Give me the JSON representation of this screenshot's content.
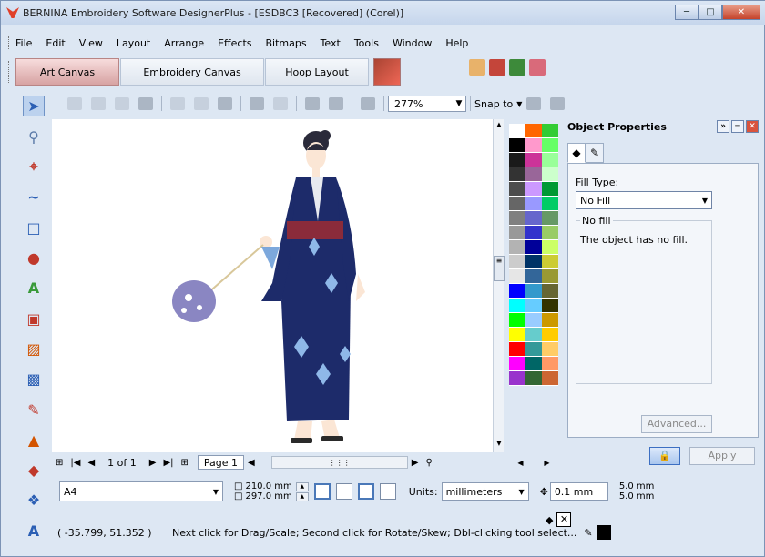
{
  "window": {
    "title": "BERNINA Embroidery Software DesignerPlus - [ESDBC3 [Recovered] (Corel)]"
  },
  "menu": [
    "File",
    "Edit",
    "View",
    "Layout",
    "Arrange",
    "Effects",
    "Bitmaps",
    "Text",
    "Tools",
    "Window",
    "Help"
  ],
  "canvas_tabs": [
    "Art Canvas",
    "Embroidery Canvas",
    "Hoop Layout"
  ],
  "toolbar": {
    "zoom": "277%",
    "snap_to": "Snap to"
  },
  "page_nav": {
    "count": "1 of 1",
    "page_tab": "Page 1"
  },
  "properties": {
    "title": "Object Properties",
    "fill_type_label": "Fill Type:",
    "fill_type_value": "No Fill",
    "group_title": "No fill",
    "group_desc": "The object has no fill.",
    "advanced_button": "Advanced...",
    "apply_button": "Apply"
  },
  "page_setup": {
    "paper": "A4",
    "width": "210.0 mm",
    "height": "297.0 mm",
    "units_label": "Units:",
    "units_value": "millimeters",
    "nudge": "0.1 mm",
    "dup_x": "5.0 mm",
    "dup_y": "5.0 mm"
  },
  "status": {
    "coords": "( -35.799, 51.352 )",
    "hint": "Next click for Drag/Scale; Second click for Rotate/Skew; Dbl-clicking tool select..."
  },
  "palette_colors": {
    "col1": [
      "#ffffff",
      "#000000",
      "#1a1a1a",
      "#333333",
      "#4d4d4d",
      "#666666",
      "#808080",
      "#999999",
      "#b3b3b3",
      "#cccccc",
      "#e6e6e6",
      "#0000ff",
      "#00ffff",
      "#00ff00",
      "#ffff00",
      "#ff0000",
      "#ff00ff",
      "#9933cc"
    ],
    "col2": [
      "#ff6600",
      "#ff99cc",
      "#cc3399",
      "#996699",
      "#cc99ff",
      "#9999ff",
      "#6666cc",
      "#3333cc",
      "#000099",
      "#003366",
      "#336699",
      "#3399cc",
      "#66ccff",
      "#99ccff",
      "#66cccc",
      "#339999",
      "#006666",
      "#336633"
    ],
    "col3": [
      "#33cc33",
      "#66ff66",
      "#99ff99",
      "#ccffcc",
      "#009933",
      "#00cc66",
      "#669966",
      "#99cc66",
      "#ccff66",
      "#cccc33",
      "#999933",
      "#666633",
      "#333300",
      "#cc9900",
      "#ffcc00",
      "#ffcc66",
      "#ff9966",
      "#cc6633"
    ]
  }
}
